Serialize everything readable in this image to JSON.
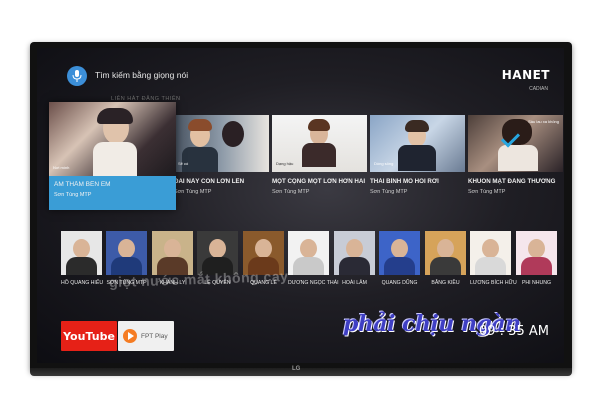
{
  "header": {
    "voice_search_label": "Tìm kiếm bằng giọng nói",
    "brand": "HANET",
    "brand_sub": "CADIAN",
    "faint_text": "LIÊN HÀT ĐĂNG THIÊN"
  },
  "videos": [
    {
      "title": "ÂM THẦM BÊN EM",
      "artist": "Sơn Tùng MTP",
      "focused": true,
      "caption": "Nơi mình"
    },
    {
      "title": "ĐAI NÀY CON LỚN LÊN",
      "artist": "Sơn Tùng MTP",
      "caption": "Sẽ có"
    },
    {
      "title": "MỘT CỘNG MỘT LỚN HƠN HAI",
      "artist": "Sơn Tùng MTP",
      "caption": "Dạng hậu"
    },
    {
      "title": "THÁI BÌNH MỒ HÔI RƠI",
      "artist": "Sơn Tùng MTP",
      "caption": "Dòng sông"
    },
    {
      "title": "KHUÔN MẶT ĐÁNG THƯƠNG",
      "artist": "Sơn Tùng MTP",
      "caption": "Sầu lau xa không"
    }
  ],
  "artists": [
    {
      "name": "HỒ QUANG HIẾU",
      "color": "#2b2b2b"
    },
    {
      "name": "SƠN TÙNG MTP",
      "color": "#1f3a7a"
    },
    {
      "name": "KHÁNH LY",
      "color": "#5a3a28"
    },
    {
      "name": "LỆ QUYÊN",
      "color": "#1f1f1f"
    },
    {
      "name": "QUANG LÊ",
      "color": "#6b3a1b"
    },
    {
      "name": "DƯƠNG NGỌC THÁI",
      "color": "#c9c9c9"
    },
    {
      "name": "HOÀI LÂM",
      "color": "#2a2a35"
    },
    {
      "name": "QUANG DŨNG",
      "color": "#243e8c"
    },
    {
      "name": "BẰNG KIỀU",
      "color": "#3a3a3a"
    },
    {
      "name": "LƯƠNG BÍCH HỮU",
      "color": "#d9d9d9"
    },
    {
      "name": "PHI NHUNG",
      "color": "#b03a5a"
    }
  ],
  "apps": {
    "youtube": "YouTube",
    "fpt": "FPT Play"
  },
  "overlay": {
    "watermark": "giọt nước mắt không cay",
    "lyric": "phải chịu ngàn",
    "clock": "09 : 35 AM"
  },
  "colors": {
    "accent": "#3a9dd6",
    "youtube_red": "#e62117",
    "lyric_blue": "#3f3fc4"
  }
}
